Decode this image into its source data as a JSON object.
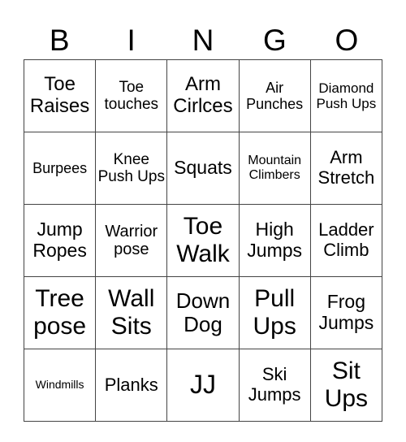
{
  "header": [
    "B",
    "I",
    "N",
    "G",
    "O"
  ],
  "rows": [
    [
      "Toe Raises",
      "Toe touches",
      "Arm Cirlces",
      "Air Punches",
      "Diamond Push Ups"
    ],
    [
      "Burpees",
      "Knee Push Ups",
      "Squats",
      "Mountain Climbers",
      "Arm Stretch"
    ],
    [
      "Jump Ropes",
      "Warrior pose",
      "Toe Walk",
      "High Jumps",
      "Ladder Climb"
    ],
    [
      "Tree pose",
      "Wall Sits",
      "Down Dog",
      "Pull Ups",
      "Frog Jumps"
    ],
    [
      "Windmills",
      "Planks",
      "JJ",
      "Ski Jumps",
      "Sit Ups"
    ]
  ]
}
